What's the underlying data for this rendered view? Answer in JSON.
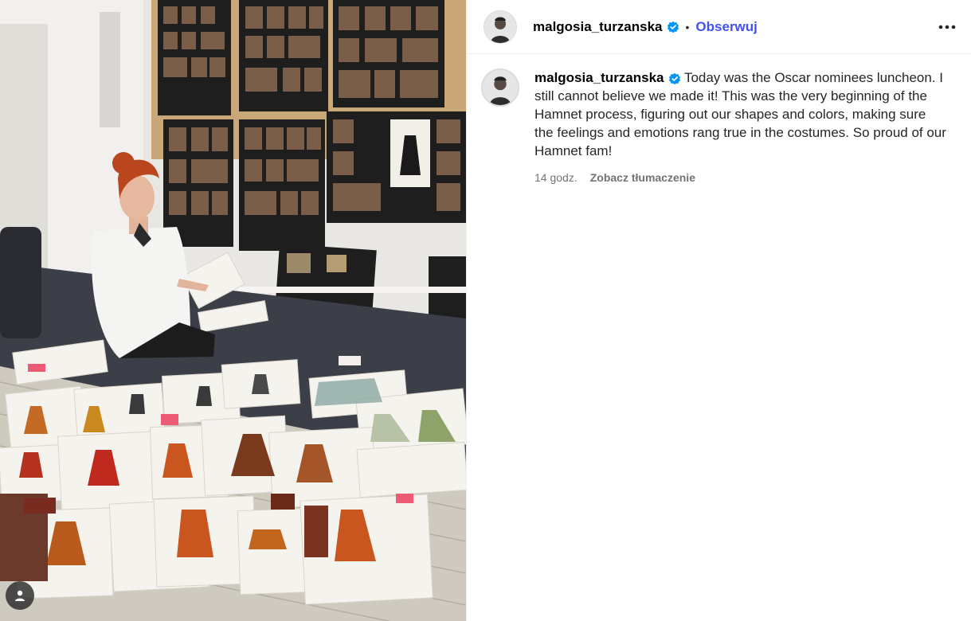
{
  "post": {
    "author": "malgosia_turzanska",
    "follow_label": "Obserwuj",
    "separator": "•",
    "caption": "Today was the Oscar nominees luncheon. I still cannot believe we made it! This was the very beginning of the Hamnet process, figuring out our shapes and colors, making sure the feelings and emotions rang true in the costumes. So proud of our Hamnet fam!",
    "time_ago": "14 godz.",
    "translate_label": "Zobacz tłumaczenie"
  },
  "colors": {
    "follow": "#4150f7",
    "verified": "#0095f6",
    "muted": "#737373"
  },
  "icons": [
    "verified-badge-icon",
    "more-options-icon",
    "user-tag-icon"
  ]
}
